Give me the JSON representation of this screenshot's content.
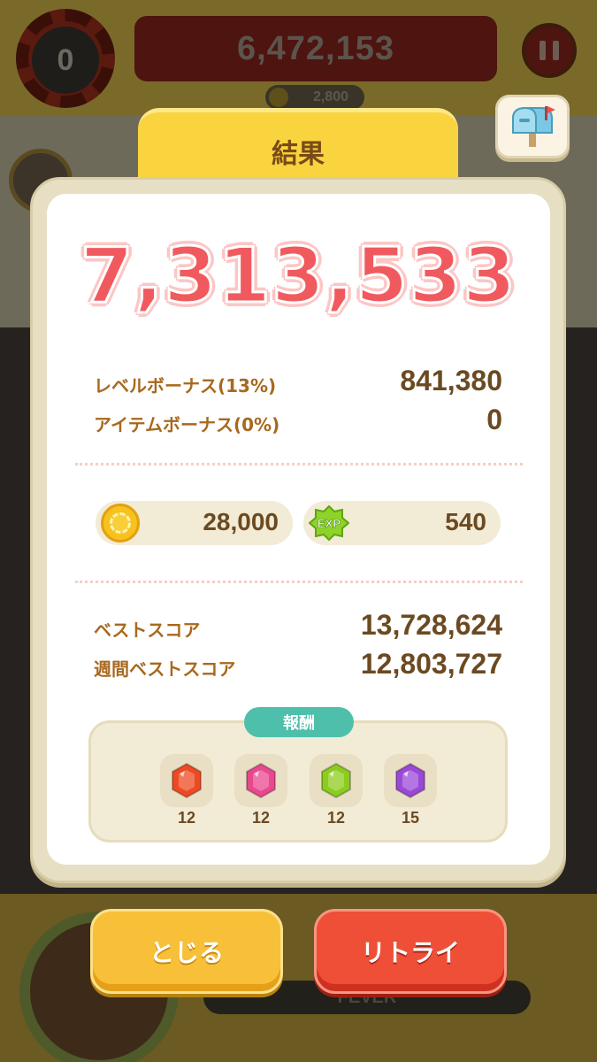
{
  "background": {
    "combo_count": "0",
    "top_score": "6,472,153",
    "coin_count": "2,800",
    "fever_label": "FEVER"
  },
  "icons": {
    "mailbox": "mailbox-icon",
    "pause": "pause-icon",
    "coin": "coin-icon",
    "exp": "exp-icon"
  },
  "result": {
    "title": "結果",
    "score": "7,313,533",
    "level_bonus_label": "レベルボーナス(13%)",
    "level_bonus_value": "841,380",
    "item_bonus_label": "アイテムボーナス(0%)",
    "item_bonus_value": "0",
    "coins_earned": "28,000",
    "exp_label": "EXP",
    "exp_earned": "540",
    "best_score_label": "ベストスコア",
    "best_score_value": "13,728,624",
    "weekly_best_label": "週間ベストスコア",
    "weekly_best_value": "12,803,727"
  },
  "rewards": {
    "title": "報酬",
    "items": [
      {
        "gem": "red-gem",
        "color": "#ee4a22",
        "count": "12"
      },
      {
        "gem": "pink-gem",
        "color": "#e9488f",
        "count": "12"
      },
      {
        "gem": "green-gem",
        "color": "#8ccc1e",
        "count": "12"
      },
      {
        "gem": "purple-gem",
        "color": "#9a48d8",
        "count": "15"
      }
    ]
  },
  "buttons": {
    "close_label": "とじる",
    "retry_label": "リトライ"
  },
  "colors": {
    "score_red": "#f05a5e",
    "label_brown": "#a8691e",
    "value_brown": "#6b4a22",
    "title_yellow": "#f9d43e",
    "reward_teal": "#4dbfab",
    "close_button": "#f7c038",
    "retry_button": "#ef4f37"
  }
}
